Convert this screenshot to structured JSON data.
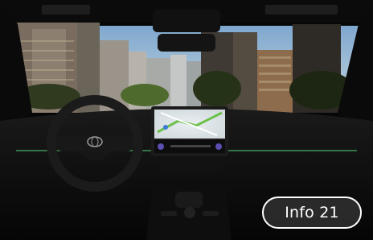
{
  "info_badge": {
    "label": "Info 21"
  },
  "colors": {
    "ambient_light": "#3f8f55",
    "sky": "#8fb6d9",
    "interior": "#0c0c0c",
    "badge_border": "#ffffff"
  },
  "icons": [
    "toyota-logo-icon",
    "map-icon"
  ]
}
